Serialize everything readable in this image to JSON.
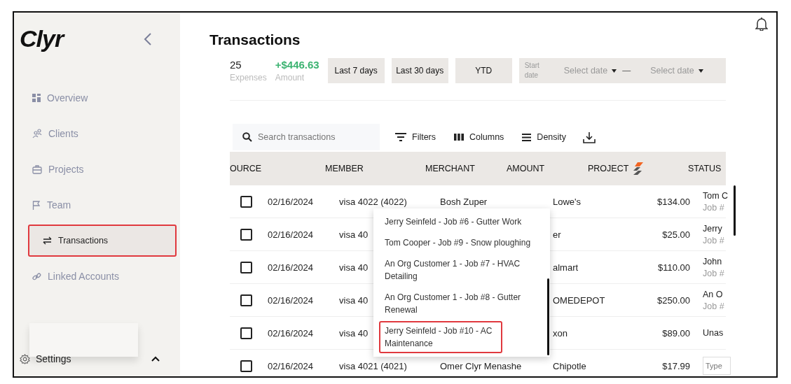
{
  "logo": "Clyr",
  "sidebar": {
    "items": [
      {
        "label": "Overview",
        "selected": false,
        "highlighted": false
      },
      {
        "label": "Clients",
        "selected": false,
        "highlighted": false
      },
      {
        "label": "Projects",
        "selected": false,
        "highlighted": false
      },
      {
        "label": "Team",
        "selected": false,
        "highlighted": false
      },
      {
        "label": "Transactions",
        "selected": true,
        "highlighted": true
      },
      {
        "label": "Linked Accounts",
        "selected": false,
        "highlighted": false
      }
    ],
    "settings": "Settings"
  },
  "page_title": "Transactions",
  "stats": [
    {
      "value": "25",
      "label": "Expenses",
      "kind": "count"
    },
    {
      "value": "+$446.63",
      "label": "Amount",
      "kind": "money"
    }
  ],
  "range_buttons": [
    "Last 7 days",
    "Last 30 days",
    "YTD"
  ],
  "date_range": {
    "label": "Start date",
    "start_placeholder": "Select date",
    "separator": "—",
    "end_placeholder": "Select date"
  },
  "toolbar": {
    "search_placeholder": "Search transactions",
    "buttons": [
      "Filters",
      "Columns",
      "Density"
    ]
  },
  "table": {
    "columns": [
      "OURCE",
      "MEMBER",
      "MERCHANT",
      "AMOUNT",
      "PROJECT",
      "STATUS"
    ],
    "rows": [
      {
        "checked": false,
        "date": "02/16/2024",
        "member": "visa 4022 (4022)",
        "column_3": "Bosh Zuper",
        "merchant": "Lowe's",
        "amount": "$134.00",
        "status": {
          "kind": "text",
          "lines": [
            "Tom C",
            "Job #"
          ]
        }
      },
      {
        "checked": false,
        "date": "02/16/2024",
        "member": "visa 40",
        "merchant": "er",
        "amount": "$25.00",
        "status": {
          "kind": "text",
          "lines": [
            "Jerry",
            "Job #"
          ]
        }
      },
      {
        "checked": false,
        "date": "02/16/2024",
        "member": "visa 40",
        "merchant": "almart",
        "amount": "$110.00",
        "status": {
          "kind": "text",
          "lines": [
            "John",
            "Job #"
          ]
        }
      },
      {
        "checked": false,
        "date": "02/16/2024",
        "member": "visa 40",
        "merchant": "OMEDEPOT",
        "amount": "$250.00",
        "status": {
          "kind": "text",
          "lines": [
            "An O",
            "Job #"
          ]
        }
      },
      {
        "checked": false,
        "date": "02/16/2024",
        "member": "visa 40",
        "merchant": "xon",
        "amount": "$89.00",
        "status": {
          "kind": "text",
          "lines": [
            "Unas"
          ]
        }
      },
      {
        "checked": false,
        "date": "02/16/2024",
        "member": "visa 4021 (4021)",
        "column_3": "Omer Clyr Menashe",
        "merchant": "Chipotle",
        "amount": "$17.99",
        "status": {
          "kind": "field",
          "placeholder": "Type"
        }
      }
    ]
  },
  "dropdown": {
    "options": [
      {
        "label": "Jerry Seinfeld - Job #6 - Gutter Work",
        "highlighted": false
      },
      {
        "label": "Tom Cooper - Job #9 - Snow ploughing",
        "highlighted": false
      },
      {
        "label": "An Org Customer 1 - Job #7 - HVAC Detailing",
        "highlighted": false
      },
      {
        "label": "An Org Customer 1 - Job #8 - Gutter Renewal",
        "highlighted": false
      },
      {
        "label": "Jerry Seinfeld - Job #10 - AC Maintenance",
        "highlighted": true
      }
    ]
  }
}
